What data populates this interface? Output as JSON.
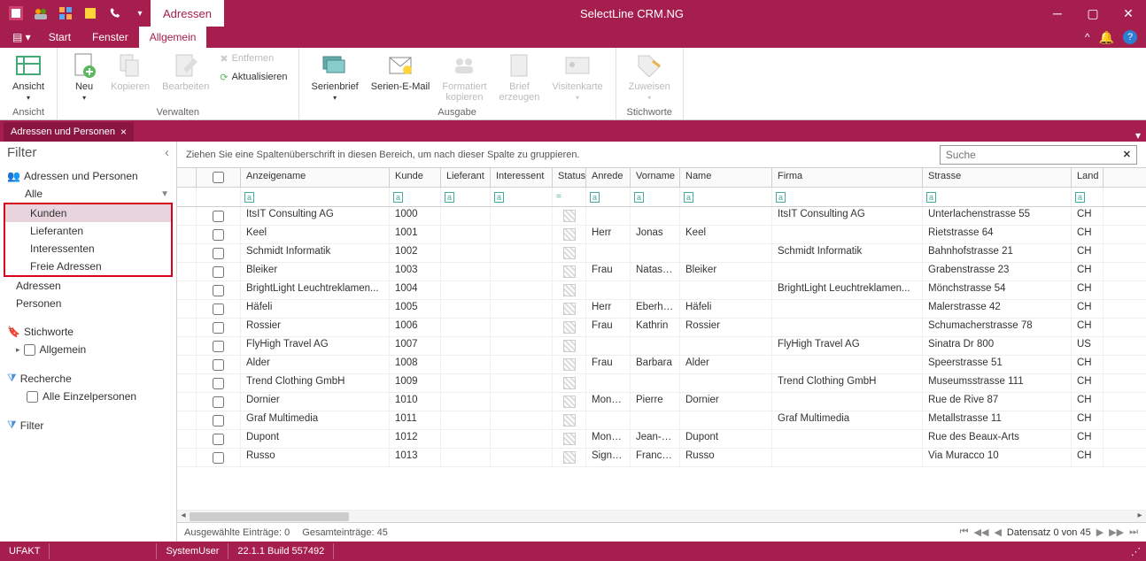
{
  "app_title": "SelectLine CRM.NG",
  "titlebar_tab": "Adressen",
  "menu": {
    "file_icon": "≡",
    "start": "Start",
    "fenster": "Fenster",
    "allgemein": "Allgemein"
  },
  "ribbon": {
    "ansicht": {
      "label": "Ansicht",
      "group": "Ansicht"
    },
    "verwalten": {
      "group": "Verwalten",
      "neu": "Neu",
      "kopieren": "Kopieren",
      "bearbeiten": "Bearbeiten",
      "entfernen": "Entfernen",
      "aktualisieren": "Aktualisieren"
    },
    "ausgabe": {
      "group": "Ausgabe",
      "serienbrief": "Serienbrief",
      "serienemail": "Serien-E-Mail",
      "formatiert": "Formatiert\nkopieren",
      "brief": "Brief\nerzeugen",
      "visitenkarte": "Visitenkarte"
    },
    "stichworte": {
      "group": "Stichworte",
      "zuweisen": "Zuweisen"
    }
  },
  "doc_tab": "Adressen und Personen",
  "filter": {
    "title": "Filter",
    "section1": "Adressen und Personen",
    "alle": "Alle",
    "kunden": "Kunden",
    "lieferanten": "Lieferanten",
    "interessenten": "Interessenten",
    "freie": "Freie Adressen",
    "adressen": "Adressen",
    "personen": "Personen",
    "stichworte": "Stichworte",
    "allgemein": "Allgemein",
    "recherche": "Recherche",
    "alle_einzel": "Alle Einzelpersonen",
    "filter_sec": "Filter"
  },
  "group_hint": "Ziehen Sie eine Spaltenüberschrift in diesen Bereich, um nach dieser Spalte zu gruppieren.",
  "search_placeholder": "Suche",
  "columns": {
    "anzeigename": "Anzeigename",
    "kunde": "Kunde",
    "lieferant": "Lieferant",
    "interessent": "Interessent",
    "status": "Status",
    "anrede": "Anrede",
    "vorname": "Vorname",
    "name": "Name",
    "firma": "Firma",
    "strasse": "Strasse",
    "land": "Land"
  },
  "rows": [
    {
      "anz": "ItsIT Consulting AG",
      "kun": "1000",
      "anr": "",
      "vor": "",
      "name": "",
      "fir": "ItsIT Consulting AG",
      "str": "Unterlachenstrasse 55",
      "land": "CH"
    },
    {
      "anz": "Keel",
      "kun": "1001",
      "anr": "Herr",
      "vor": "Jonas",
      "name": "Keel",
      "fir": "",
      "str": "Rietstrasse 64",
      "land": "CH"
    },
    {
      "anz": "Schmidt Informatik",
      "kun": "1002",
      "anr": "",
      "vor": "",
      "name": "",
      "fir": "Schmidt Informatik",
      "str": "Bahnhofstrasse 21",
      "land": "CH"
    },
    {
      "anz": "Bleiker",
      "kun": "1003",
      "anr": "Frau",
      "vor": "Natasc...",
      "name": "Bleiker",
      "fir": "",
      "str": "Grabenstrasse 23",
      "land": "CH"
    },
    {
      "anz": "BrightLight Leuchtreklamen...",
      "kun": "1004",
      "anr": "",
      "vor": "",
      "name": "",
      "fir": "BrightLight Leuchtreklamen...",
      "str": "Mönchstrasse 54",
      "land": "CH"
    },
    {
      "anz": "Häfeli",
      "kun": "1005",
      "anr": "Herr",
      "vor": "Eberhard",
      "name": "Häfeli",
      "fir": "",
      "str": "Malerstrasse 42",
      "land": "CH"
    },
    {
      "anz": "Rossier",
      "kun": "1006",
      "anr": "Frau",
      "vor": "Kathrin",
      "name": "Rossier",
      "fir": "",
      "str": "Schumacherstrasse 78",
      "land": "CH"
    },
    {
      "anz": "FlyHigh Travel AG",
      "kun": "1007",
      "anr": "",
      "vor": "",
      "name": "",
      "fir": "FlyHigh Travel AG",
      "str": "Sinatra Dr 800",
      "land": "US"
    },
    {
      "anz": "Alder",
      "kun": "1008",
      "anr": "Frau",
      "vor": "Barbara",
      "name": "Alder",
      "fir": "",
      "str": "Speerstrasse 51",
      "land": "CH"
    },
    {
      "anz": "Trend Clothing GmbH",
      "kun": "1009",
      "anr": "",
      "vor": "",
      "name": "",
      "fir": "Trend Clothing GmbH",
      "str": "Museumsstrasse 111",
      "land": "CH"
    },
    {
      "anz": "Dornier",
      "kun": "1010",
      "anr": "Mons...",
      "vor": "Pierre",
      "name": "Dornier",
      "fir": "",
      "str": "Rue de Rive 87",
      "land": "CH"
    },
    {
      "anz": "Graf Multimedia",
      "kun": "1011",
      "anr": "",
      "vor": "",
      "name": "",
      "fir": "Graf Multimedia",
      "str": "Metallstrasse 11",
      "land": "CH"
    },
    {
      "anz": "Dupont",
      "kun": "1012",
      "anr": "Mons...",
      "vor": "Jean-Luc",
      "name": "Dupont",
      "fir": "",
      "str": "Rue des Beaux-Arts",
      "land": "CH"
    },
    {
      "anz": "Russo",
      "kun": "1013",
      "anr": "Signo...",
      "vor": "France...",
      "name": "Russo",
      "fir": "",
      "str": "Via Muracco 10",
      "land": "CH"
    }
  ],
  "footer": {
    "selected_label": "Ausgewählte Einträge:",
    "selected_count": "0",
    "total_label": "Gesamteinträge:",
    "total_count": "45",
    "record_label": "Datensatz 0 von 45"
  },
  "status": {
    "db": "UFAKT",
    "user": "SystemUser",
    "version": "22.1.1 Build 557492"
  }
}
